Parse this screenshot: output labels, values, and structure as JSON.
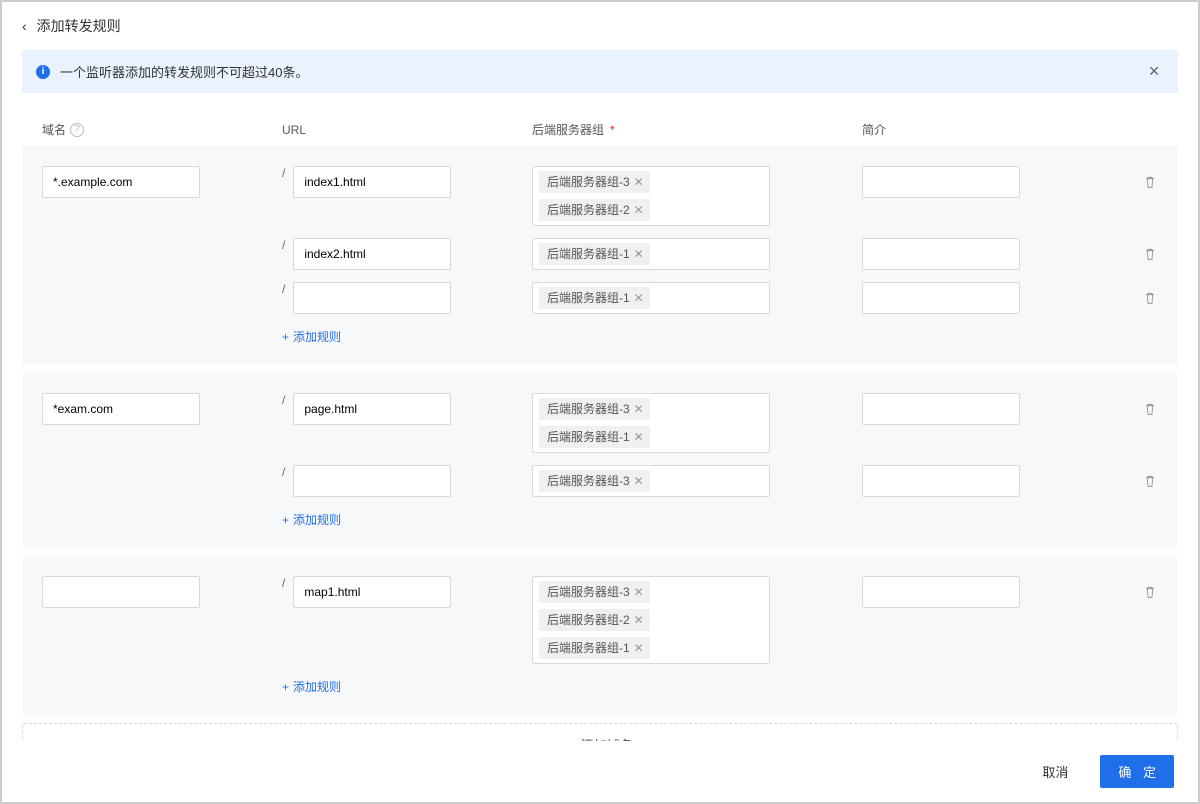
{
  "header": {
    "title": "添加转发规则"
  },
  "alert": {
    "text": "一个监听器添加的转发规则不可超过40条。"
  },
  "columns": {
    "domain": "域名",
    "url": "URL",
    "backend": "后端服务器组",
    "desc": "简介"
  },
  "actions": {
    "addRule": "添加规则",
    "addDomain": "添加域名",
    "cancel": "取消",
    "confirm": "确 定"
  },
  "blocks": [
    {
      "domain": "*.example.com",
      "rules": [
        {
          "url": "index1.html",
          "tags": [
            "后端服务器组-3",
            "后端服务器组-2"
          ],
          "desc": ""
        },
        {
          "url": "index2.html",
          "tags": [
            "后端服务器组-1"
          ],
          "desc": ""
        },
        {
          "url": "",
          "tags": [
            "后端服务器组-1"
          ],
          "desc": ""
        }
      ]
    },
    {
      "domain": "*exam.com",
      "rules": [
        {
          "url": "page.html",
          "tags": [
            "后端服务器组-3",
            "后端服务器组-1"
          ],
          "desc": ""
        },
        {
          "url": "",
          "tags": [
            "后端服务器组-3"
          ],
          "desc": ""
        }
      ]
    },
    {
      "domain": "",
      "rules": [
        {
          "url": "map1.html",
          "tags": [
            "后端服务器组-3",
            "后端服务器组-2",
            "后端服务器组-1"
          ],
          "desc": ""
        }
      ]
    }
  ]
}
